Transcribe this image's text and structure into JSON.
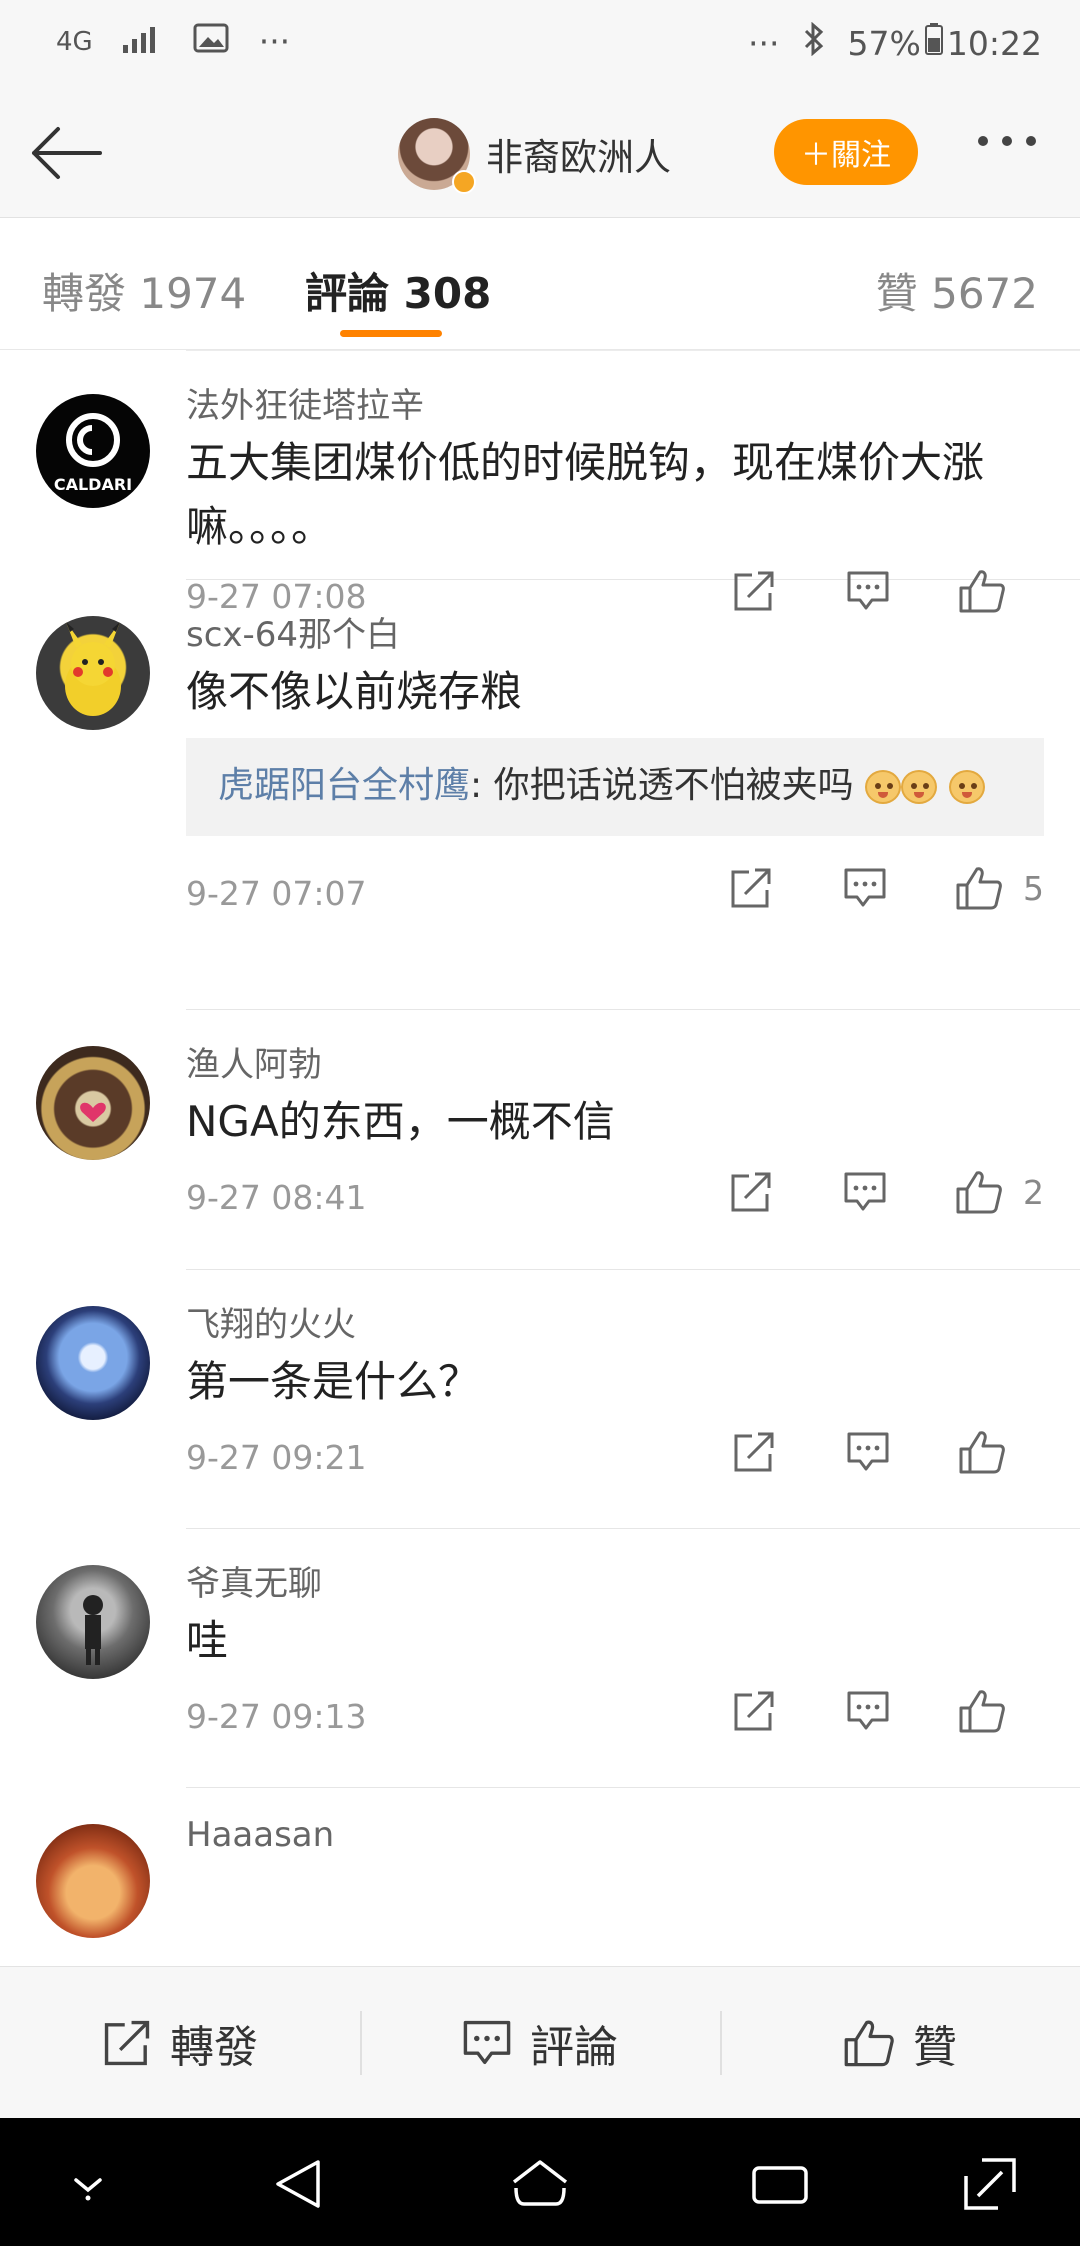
{
  "status_bar": {
    "network": "4G",
    "more": "···",
    "right_more": "···",
    "battery": "57%",
    "time": "10:22"
  },
  "header": {
    "title": "非裔欧洲人",
    "follow_label": "＋關注",
    "accent_color": "#ff9500"
  },
  "tabs": {
    "repost": "轉發 1974",
    "comments": "評論 308",
    "likes": "贊 5672"
  },
  "comments": [
    {
      "name": "法外狂徒塔拉辛",
      "text": "五大集团煤价低的时候脱钩，现在煤价大涨嘛。。。。",
      "time": "9-27 07:08",
      "likes": "",
      "avatar_label": "CALDARI"
    },
    {
      "name": "scx-64那个白",
      "text": "像不像以前烧存粮",
      "time": "9-27 07:07",
      "likes": "5",
      "reply": {
        "user": "虎踞阳台全村鹰",
        "text": ": 你把话说透不怕被夹吗"
      }
    },
    {
      "name": "渔人阿勃",
      "text": "NGA的东西，一概不信",
      "time": "9-27 08:41",
      "likes": "2"
    },
    {
      "name": "飞翔的火火",
      "text": "第一条是什么？",
      "time": "9-27 09:21",
      "likes": ""
    },
    {
      "name": "爷真无聊",
      "text": "哇",
      "time": "9-27 09:13",
      "likes": ""
    },
    {
      "name": "Haaasan"
    }
  ],
  "bottom_bar": {
    "repost": "轉發",
    "comment": "評論",
    "like": "贊"
  }
}
